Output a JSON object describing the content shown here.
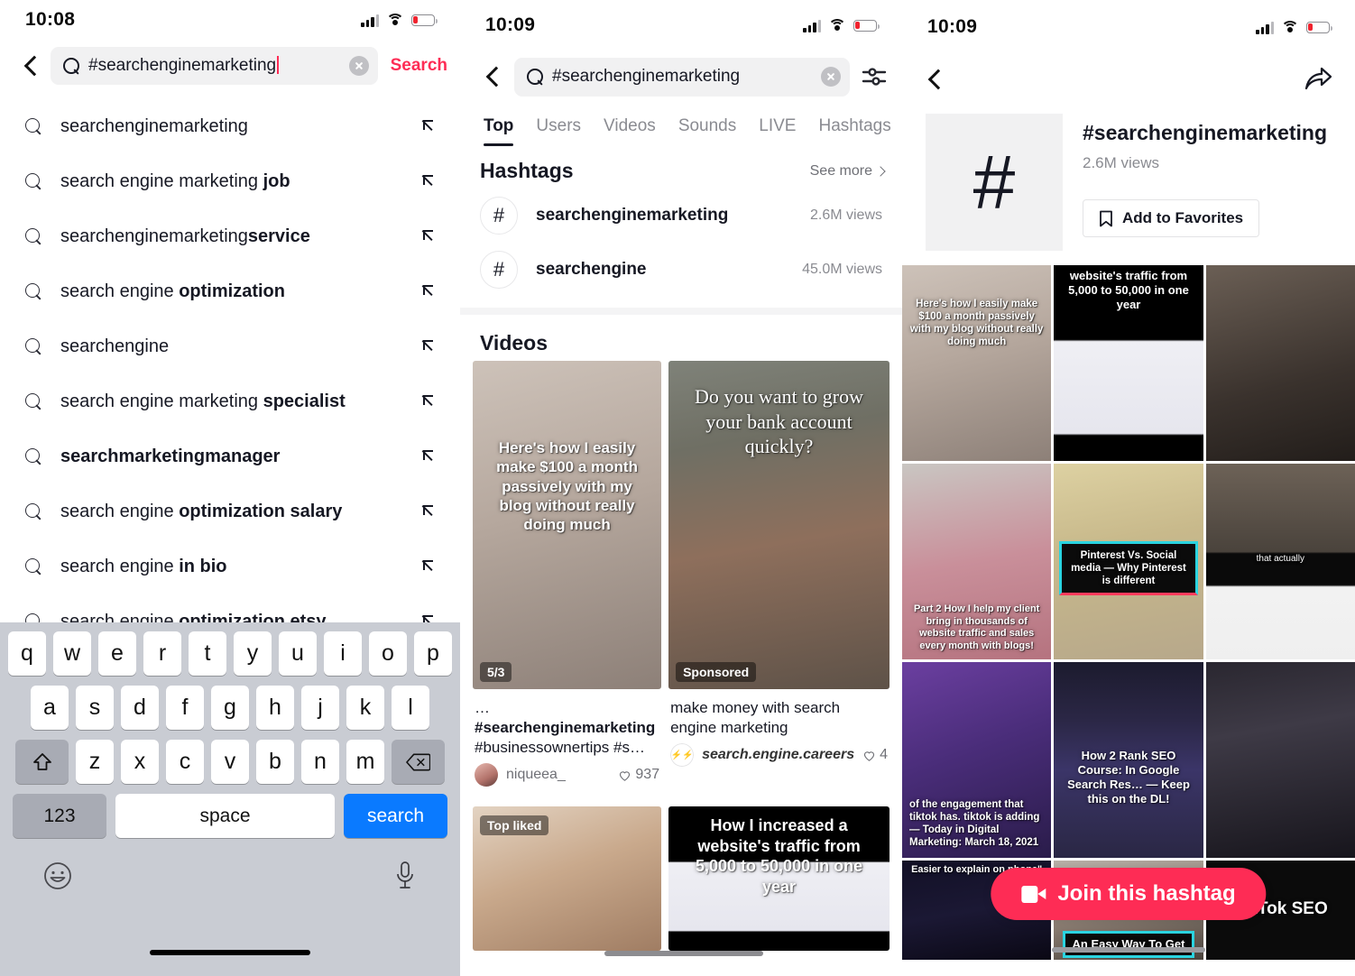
{
  "panel1": {
    "status": {
      "time": "10:08"
    },
    "search": {
      "value": "#searchenginemarketing",
      "action_label": "Search",
      "back_icon": "back-chevron-icon",
      "clear_icon": "clear-circle-icon",
      "search_icon": "search-icon"
    },
    "suggestions": [
      {
        "plain": "searchenginemarketing",
        "bold": ""
      },
      {
        "plain": "search engine marketing ",
        "bold": "job"
      },
      {
        "plain": "searchenginemarketing",
        "bold": "service"
      },
      {
        "plain": "search engine ",
        "bold": "optimization"
      },
      {
        "plain": "searchengine",
        "bold": ""
      },
      {
        "plain": "search engine marketing ",
        "bold": "specialist"
      },
      {
        "plain": "",
        "bold": "searchmarketingmanager"
      },
      {
        "plain": "search engine ",
        "bold": "optimization salary"
      },
      {
        "plain": "search engine ",
        "bold": "in bio"
      },
      {
        "plain": "search engine ",
        "bold": "optimization etsy"
      }
    ],
    "keyboard": {
      "row1": [
        "q",
        "w",
        "e",
        "r",
        "t",
        "y",
        "u",
        "i",
        "o",
        "p"
      ],
      "row2": [
        "a",
        "s",
        "d",
        "f",
        "g",
        "h",
        "j",
        "k",
        "l"
      ],
      "row3": [
        "z",
        "x",
        "c",
        "v",
        "b",
        "n",
        "m"
      ],
      "shift_icon": "shift-up-arrow-icon",
      "delete_icon": "backspace-icon",
      "numbers_label": "123",
      "space_label": "space",
      "go_label": "search",
      "emoji_icon": "emoji-smiley-icon",
      "mic_icon": "microphone-icon"
    }
  },
  "panel2": {
    "status": {
      "time": "10:09"
    },
    "search": {
      "value": "#searchenginemarketing",
      "filter_icon": "filter-sliders-icon",
      "clear_icon": "clear-circle-icon"
    },
    "tabs": [
      {
        "label": "Top",
        "active": true
      },
      {
        "label": "Users",
        "active": false
      },
      {
        "label": "Videos",
        "active": false
      },
      {
        "label": "Sounds",
        "active": false
      },
      {
        "label": "LIVE",
        "active": false
      },
      {
        "label": "Hashtags",
        "active": false
      }
    ],
    "hashtags_section": {
      "title": "Hashtags",
      "see_more": "See more",
      "items": [
        {
          "name": "searchenginemarketing",
          "views": "2.6M views"
        },
        {
          "name": "searchengine",
          "views": "45.0M views"
        }
      ]
    },
    "videos_section": {
      "title": "Videos",
      "cards": [
        {
          "overlay": "Here's how I easily make $100 a month passively with my blog without really doing much",
          "badge": "5/3",
          "title_plain_pre": "…",
          "title_bold": "#searchenginemarketing",
          "title_plain_post": " #businessownertips #s…",
          "author": "niqueea_",
          "likes": "937"
        },
        {
          "overlay": "Do you want to grow your bank account quickly?",
          "badge": "Sponsored",
          "title_plain_pre": "make money with search engine marketing",
          "title_bold": "",
          "title_plain_post": "",
          "author": "search.engine.careers",
          "likes": "4"
        },
        {
          "overlay": "",
          "badge": "Top liked",
          "title_plain_pre": "",
          "title_bold": "",
          "title_plain_post": "",
          "author": "",
          "likes": ""
        },
        {
          "overlay": "How I increased a website's traffic from 5,000 to 50,000 in one year",
          "badge": "",
          "title_plain_pre": "",
          "title_bold": "",
          "title_plain_post": "",
          "author": "",
          "likes": ""
        }
      ]
    }
  },
  "panel3": {
    "status": {
      "time": "10:09"
    },
    "header": {
      "back_icon": "back-chevron-icon",
      "share_icon": "share-arrow-icon"
    },
    "hero": {
      "hash_glyph": "#",
      "title": "#searchenginemarketing",
      "views": "2.6M views",
      "favorite_label": "Add to Favorites",
      "bookmark_icon": "bookmark-icon"
    },
    "grid_tiles": [
      {
        "caption": "Here's how I easily make $100 a month passively with my blog without really doing much",
        "style": "room"
      },
      {
        "caption": "website's traffic from 5,000 to 50,000 in one year",
        "style": "analytics"
      },
      {
        "caption": "",
        "style": "man"
      },
      {
        "caption": "Part 2 How I help my client bring in thousands of website traffic and sales every month with blogs!",
        "style": "pink"
      },
      {
        "caption": "Pinterest Vs. Social media — Why Pinterest is different",
        "style": "pinterest"
      },
      {
        "caption": "that actually",
        "style": "podcast"
      },
      {
        "caption": "of the engagement that tiktok has. tiktok is adding — Today in Digital Marketing: March 18, 2021",
        "style": "purple"
      },
      {
        "caption": "How 2 Rank SEO Course: In Google Search Res… — Keep this on the DL!",
        "style": "screen"
      },
      {
        "caption": "",
        "style": "laptop"
      },
      {
        "caption": "Easier to explain on phone\"",
        "style": "blue"
      },
      {
        "caption": "An Easy Way To Get",
        "style": "face2"
      },
      {
        "caption": "TikTok SEO",
        "style": "seo"
      }
    ],
    "join_button": {
      "label": "Join this hashtag",
      "icon": "video-camera-icon"
    }
  },
  "colors": {
    "accent_red": "#fe2c55",
    "text_primary": "#161823",
    "text_secondary": "#8a8b91",
    "field_bg": "#f1f1f2",
    "keyboard_bg": "#c9ccd3",
    "key_blue": "#0a7aff"
  }
}
